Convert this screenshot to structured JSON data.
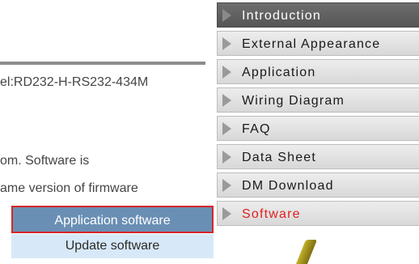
{
  "left": {
    "model_text": "el:RD232-H-RS232-434M",
    "software_text": "om. Software is",
    "firmware_text": "ame version of firmware",
    "application_software_button": "Application software",
    "update_software_button": "Update software"
  },
  "sidebar": {
    "items": [
      {
        "label": "Introduction"
      },
      {
        "label": "External Appearance"
      },
      {
        "label": "Application"
      },
      {
        "label": "Wiring Diagram"
      },
      {
        "label": "FAQ"
      },
      {
        "label": "Data Sheet"
      },
      {
        "label": "DM Download"
      },
      {
        "label": "Software"
      }
    ]
  },
  "colors": {
    "active_item": "#5f5f5f",
    "software_label": "#e02020",
    "app_button_bg": "#6a8fb4",
    "app_button_border": "#d6262a",
    "update_button_bg": "#d7e9f8"
  }
}
